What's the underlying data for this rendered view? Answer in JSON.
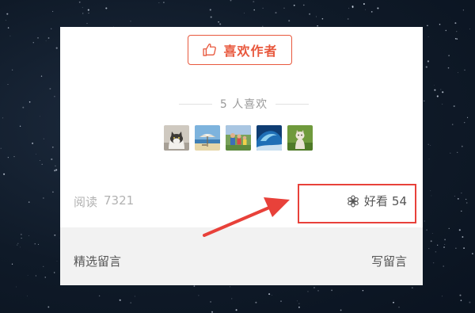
{
  "like_button": {
    "label": "喜欢作者",
    "icon": "thumbs-up-icon",
    "color": "#e8583d"
  },
  "likes_summary": {
    "count": "5",
    "text": "人喜欢"
  },
  "avatars": [
    {
      "icon": "cat-photo"
    },
    {
      "icon": "beach-umbrella-photo"
    },
    {
      "icon": "family-photo"
    },
    {
      "icon": "ocean-wave-photo"
    },
    {
      "icon": "kitten-grass-photo"
    }
  ],
  "stats": {
    "reads_label": "阅读",
    "reads_value": "7321",
    "wow_label": "好看",
    "wow_value": "54",
    "wow_icon": "flower-icon"
  },
  "footer": {
    "left_label": "精选留言",
    "right_label": "写留言"
  },
  "annotation": {
    "highlight_color": "#e8413a",
    "arrow_color": "#e8413a"
  }
}
